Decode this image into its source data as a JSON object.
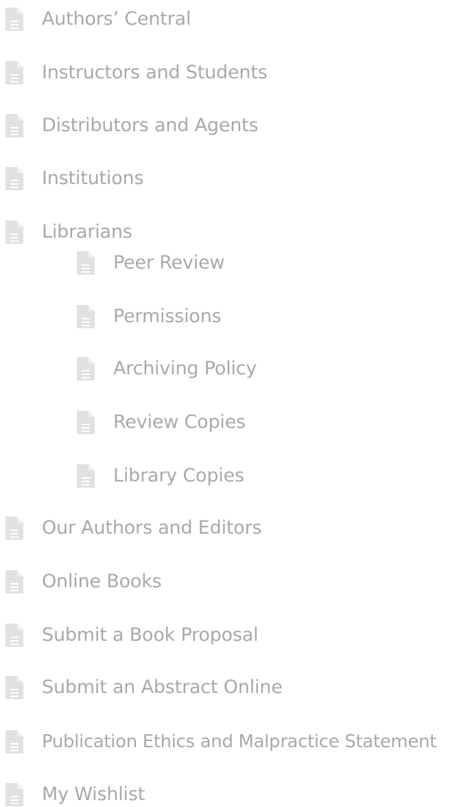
{
  "menu": {
    "items": [
      {
        "label": "Authors’ Central",
        "icon": "document-icon"
      },
      {
        "label": "Instructors and Students",
        "icon": "document-icon"
      },
      {
        "label": "Distributors and Agents",
        "icon": "document-icon"
      },
      {
        "label": "Institutions",
        "icon": "document-icon"
      },
      {
        "label": "Librarians",
        "icon": "document-icon"
      },
      {
        "label": "Our Authors and Editors",
        "icon": "document-icon"
      },
      {
        "label": "Online Books",
        "icon": "document-icon"
      },
      {
        "label": "Submit a Book Proposal",
        "icon": "document-icon"
      },
      {
        "label": "Submit an Abstract Online",
        "icon": "document-icon"
      },
      {
        "label": "Publication Ethics and Malpractice Statement",
        "icon": "document-icon"
      },
      {
        "label": "My Wishlist",
        "icon": "document-icon"
      }
    ],
    "librarians_subitems": [
      {
        "label": "Peer Review",
        "icon": "document-icon"
      },
      {
        "label": "Permissions",
        "icon": "document-icon"
      },
      {
        "label": "Archiving Policy",
        "icon": "document-icon"
      },
      {
        "label": "Review Copies",
        "icon": "document-icon"
      },
      {
        "label": "Library Copies",
        "icon": "document-icon"
      }
    ]
  },
  "colors": {
    "text": "#a9a9a9",
    "icon": "#e1e1e1",
    "icon_lines": "#ffffff"
  }
}
